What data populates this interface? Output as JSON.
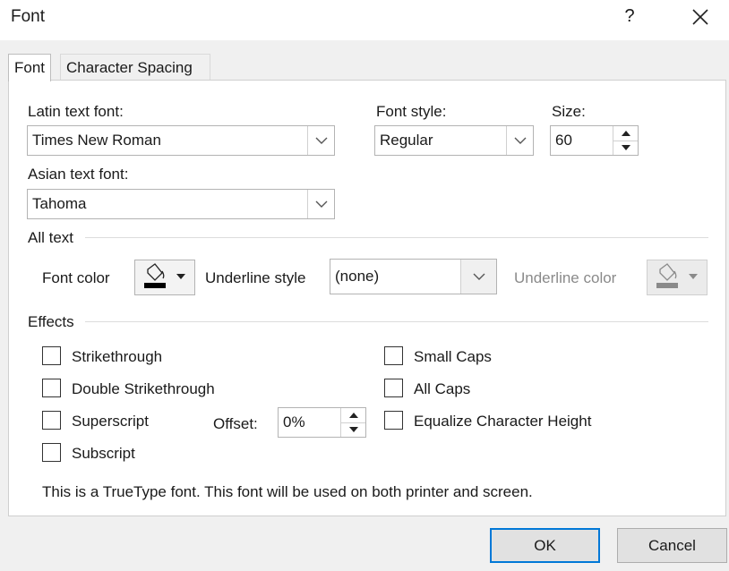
{
  "window": {
    "title": "Font",
    "help": "?"
  },
  "tabs": [
    {
      "label": "Font",
      "active": true
    },
    {
      "label": "Character Spacing",
      "active": false
    }
  ],
  "fonts": {
    "latin_label": "Latin text font:",
    "latin_value": "Times New Roman",
    "style_label": "Font style:",
    "style_value": "Regular",
    "size_label": "Size:",
    "size_value": "60",
    "asian_label": "Asian text font:",
    "asian_value": "Tahoma"
  },
  "all_text": {
    "section": "All text",
    "font_color_label": "Font color",
    "underline_style_label": "Underline style",
    "underline_style_value": "(none)",
    "underline_color_label": "Underline color",
    "font_color": "#000000",
    "underline_color": "#8a8a8a"
  },
  "effects": {
    "section": "Effects",
    "strikethrough": "Strikethrough",
    "double_strikethrough": "Double Strikethrough",
    "superscript": "Superscript",
    "subscript": "Subscript",
    "offset_label": "Offset:",
    "offset_value": "0%",
    "small_caps": "Small Caps",
    "all_caps": "All Caps",
    "equalize": "Equalize Character Height"
  },
  "info": "This is a TrueType font. This font will be used on both printer and screen.",
  "buttons": {
    "ok": "OK",
    "cancel": "Cancel"
  },
  "colors": {
    "accent": "#0078d7",
    "dialog_bg": "#f0f0f0"
  }
}
